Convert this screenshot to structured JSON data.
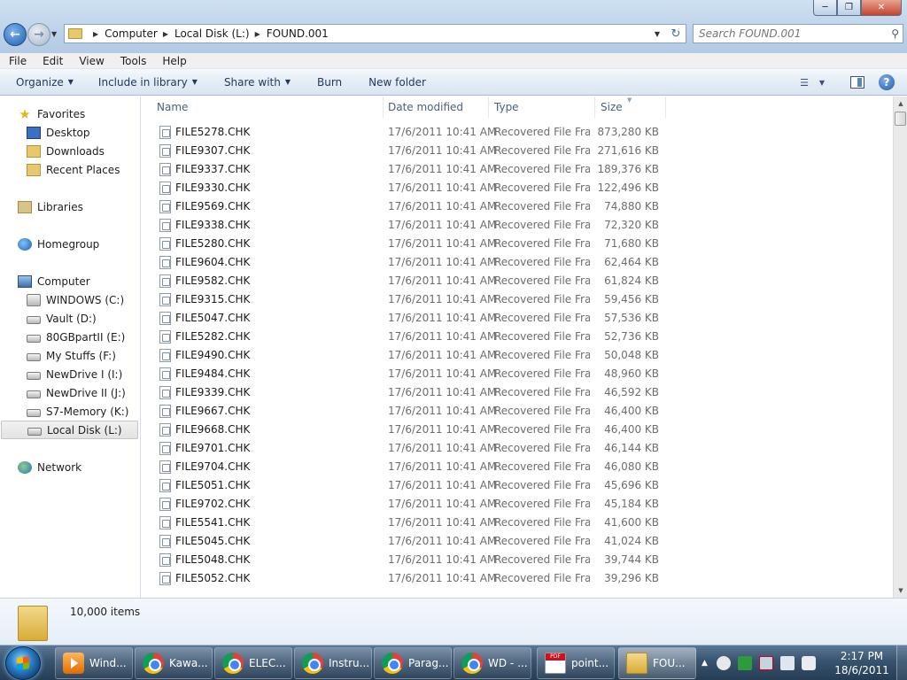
{
  "window": {
    "address": {
      "crumbs": [
        "Computer",
        "Local Disk (L:)",
        "FOUND.001"
      ]
    },
    "search_placeholder": "Search FOUND.001"
  },
  "menubar": [
    "File",
    "Edit",
    "View",
    "Tools",
    "Help"
  ],
  "commandbar": {
    "organize": "Organize",
    "include": "Include in library",
    "share": "Share with",
    "burn": "Burn",
    "newfolder": "New folder"
  },
  "navpane": {
    "favorites": "Favorites",
    "desktop": "Desktop",
    "downloads": "Downloads",
    "recent": "Recent Places",
    "libraries": "Libraries",
    "homegroup": "Homegroup",
    "computer": "Computer",
    "drives": [
      "WINDOWS (C:)",
      "Vault (D:)",
      "80GBpartII (E:)",
      "My Stuffs (F:)",
      "NewDrive I (I:)",
      "NewDrive II (J:)",
      "S7-Memory (K:)",
      "Local Disk (L:)"
    ],
    "network": "Network"
  },
  "columns": {
    "name": "Name",
    "date": "Date modified",
    "type": "Type",
    "size": "Size"
  },
  "files": [
    {
      "name": "FILE5278.CHK",
      "date": "17/6/2011 10:41 AM",
      "type": "Recovered File Fra...",
      "size": "873,280 KB"
    },
    {
      "name": "FILE9307.CHK",
      "date": "17/6/2011 10:41 AM",
      "type": "Recovered File Fra...",
      "size": "271,616 KB"
    },
    {
      "name": "FILE9337.CHK",
      "date": "17/6/2011 10:41 AM",
      "type": "Recovered File Fra...",
      "size": "189,376 KB"
    },
    {
      "name": "FILE9330.CHK",
      "date": "17/6/2011 10:41 AM",
      "type": "Recovered File Fra...",
      "size": "122,496 KB"
    },
    {
      "name": "FILE9569.CHK",
      "date": "17/6/2011 10:41 AM",
      "type": "Recovered File Fra...",
      "size": "74,880 KB"
    },
    {
      "name": "FILE9338.CHK",
      "date": "17/6/2011 10:41 AM",
      "type": "Recovered File Fra...",
      "size": "72,320 KB"
    },
    {
      "name": "FILE5280.CHK",
      "date": "17/6/2011 10:41 AM",
      "type": "Recovered File Fra...",
      "size": "71,680 KB"
    },
    {
      "name": "FILE9604.CHK",
      "date": "17/6/2011 10:41 AM",
      "type": "Recovered File Fra...",
      "size": "62,464 KB"
    },
    {
      "name": "FILE9582.CHK",
      "date": "17/6/2011 10:41 AM",
      "type": "Recovered File Fra...",
      "size": "61,824 KB"
    },
    {
      "name": "FILE9315.CHK",
      "date": "17/6/2011 10:41 AM",
      "type": "Recovered File Fra...",
      "size": "59,456 KB"
    },
    {
      "name": "FILE5047.CHK",
      "date": "17/6/2011 10:41 AM",
      "type": "Recovered File Fra...",
      "size": "57,536 KB"
    },
    {
      "name": "FILE5282.CHK",
      "date": "17/6/2011 10:41 AM",
      "type": "Recovered File Fra...",
      "size": "52,736 KB"
    },
    {
      "name": "FILE9490.CHK",
      "date": "17/6/2011 10:41 AM",
      "type": "Recovered File Fra...",
      "size": "50,048 KB"
    },
    {
      "name": "FILE9484.CHK",
      "date": "17/6/2011 10:41 AM",
      "type": "Recovered File Fra...",
      "size": "48,960 KB"
    },
    {
      "name": "FILE9339.CHK",
      "date": "17/6/2011 10:41 AM",
      "type": "Recovered File Fra...",
      "size": "46,592 KB"
    },
    {
      "name": "FILE9667.CHK",
      "date": "17/6/2011 10:41 AM",
      "type": "Recovered File Fra...",
      "size": "46,400 KB"
    },
    {
      "name": "FILE9668.CHK",
      "date": "17/6/2011 10:41 AM",
      "type": "Recovered File Fra...",
      "size": "46,400 KB"
    },
    {
      "name": "FILE9701.CHK",
      "date": "17/6/2011 10:41 AM",
      "type": "Recovered File Fra...",
      "size": "46,144 KB"
    },
    {
      "name": "FILE9704.CHK",
      "date": "17/6/2011 10:41 AM",
      "type": "Recovered File Fra...",
      "size": "46,080 KB"
    },
    {
      "name": "FILE5051.CHK",
      "date": "17/6/2011 10:41 AM",
      "type": "Recovered File Fra...",
      "size": "45,696 KB"
    },
    {
      "name": "FILE9702.CHK",
      "date": "17/6/2011 10:41 AM",
      "type": "Recovered File Fra...",
      "size": "45,184 KB"
    },
    {
      "name": "FILE5541.CHK",
      "date": "17/6/2011 10:41 AM",
      "type": "Recovered File Fra...",
      "size": "41,600 KB"
    },
    {
      "name": "FILE5045.CHK",
      "date": "17/6/2011 10:41 AM",
      "type": "Recovered File Fra...",
      "size": "41,024 KB"
    },
    {
      "name": "FILE5048.CHK",
      "date": "17/6/2011 10:41 AM",
      "type": "Recovered File Fra...",
      "size": "39,744 KB"
    },
    {
      "name": "FILE5052.CHK",
      "date": "17/6/2011 10:41 AM",
      "type": "Recovered File Fra...",
      "size": "39,296 KB"
    }
  ],
  "details": {
    "count": "10,000 items"
  },
  "taskbar": {
    "items": [
      "Wind...",
      "Kawa...",
      "ELEC...",
      "Instru...",
      "Parag...",
      "WD - ...",
      "point...",
      "FOU..."
    ],
    "time": "2:17 PM",
    "date": "18/6/2011"
  }
}
